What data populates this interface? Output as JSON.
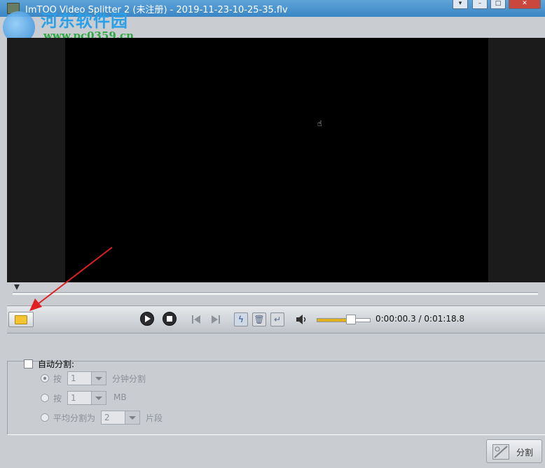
{
  "window": {
    "title": "ImTOO Video Splitter 2 (未注册) - 2019-11-23-10-25-35.flv"
  },
  "watermark": {
    "site_name": "河东软件园",
    "url": "www.pc0359.cn"
  },
  "player": {
    "current_time": "0:00:00.3",
    "separator": " / ",
    "total_time": "0:01:18.8",
    "volume_level": 0.72,
    "seek_position": 0.004
  },
  "auto_split": {
    "label": "自动分割:",
    "checked": false,
    "by_minutes": {
      "prefix": "按",
      "value": "1",
      "unit": "分钟分割",
      "selected": true
    },
    "by_size": {
      "prefix": "按",
      "value": "1",
      "unit": "MB",
      "selected": false
    },
    "even": {
      "prefix": "平均分割为",
      "value": "2",
      "unit": "片段",
      "selected": false
    }
  },
  "split_button": {
    "label": "分割"
  },
  "icons": [
    "app-icon",
    "folder-icon",
    "play-icon",
    "stop-icon",
    "prev-icon",
    "next-icon",
    "split-mark-icon",
    "delete-icon",
    "undo-icon",
    "volume-icon",
    "split-icon"
  ],
  "colors": {
    "title_bar": "#3a86c5",
    "volume_fill": "#e2b21e",
    "annotation_arrow": "#e02020"
  }
}
